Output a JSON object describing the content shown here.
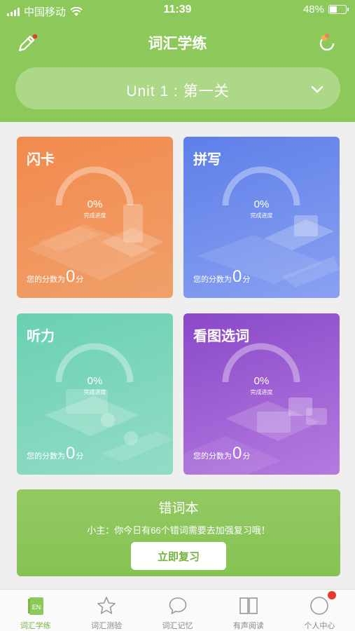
{
  "status_bar": {
    "carrier": "中国移动",
    "time": "11:39",
    "battery": "48%",
    "battery_level": 0.48
  },
  "header": {
    "title": "词汇学练",
    "edit_icon": "pencil-icon",
    "sync_icon": "refresh-icon"
  },
  "unit_selector": {
    "value": "Unit 1 : 第一关",
    "icon": "chevron-down-icon"
  },
  "cards": [
    {
      "title": "闪卡",
      "progress": "0%",
      "progress_label": "完成进度",
      "score_prefix": "您的分数为",
      "score": "0",
      "score_unit": "分",
      "color": "#f28a4d"
    },
    {
      "title": "拼写",
      "progress": "0%",
      "progress_label": "完成进度",
      "score_prefix": "您的分数为",
      "score": "0",
      "score_unit": "分",
      "color": "#5d7fe8"
    },
    {
      "title": "听力",
      "progress": "0%",
      "progress_label": "完成进度",
      "score_prefix": "您的分数为",
      "score": "0",
      "score_unit": "分",
      "color": "#69d0b2"
    },
    {
      "title": "看图选词",
      "progress": "0%",
      "progress_label": "完成进度",
      "score_prefix": "您的分数为",
      "score": "0",
      "score_unit": "分",
      "color": "#8a48c8"
    }
  ],
  "mistake_book": {
    "title": "错词本",
    "message": "小主：你今日有66个错词需要去加强复习哦！",
    "button": "立即复习"
  },
  "tabbar": {
    "items": [
      {
        "label": "词汇学练",
        "icon": "en-book-icon",
        "active": true
      },
      {
        "label": "词汇测验",
        "icon": "star-icon",
        "active": false
      },
      {
        "label": "词汇记忆",
        "icon": "chat-bubble-icon",
        "active": false
      },
      {
        "label": "有声阅读",
        "icon": "book-icon",
        "active": false
      },
      {
        "label": "个人中心",
        "icon": "user-circle-icon",
        "active": false
      }
    ]
  },
  "colors": {
    "accent": "#8dc95a",
    "badge": "#e53b2f"
  }
}
